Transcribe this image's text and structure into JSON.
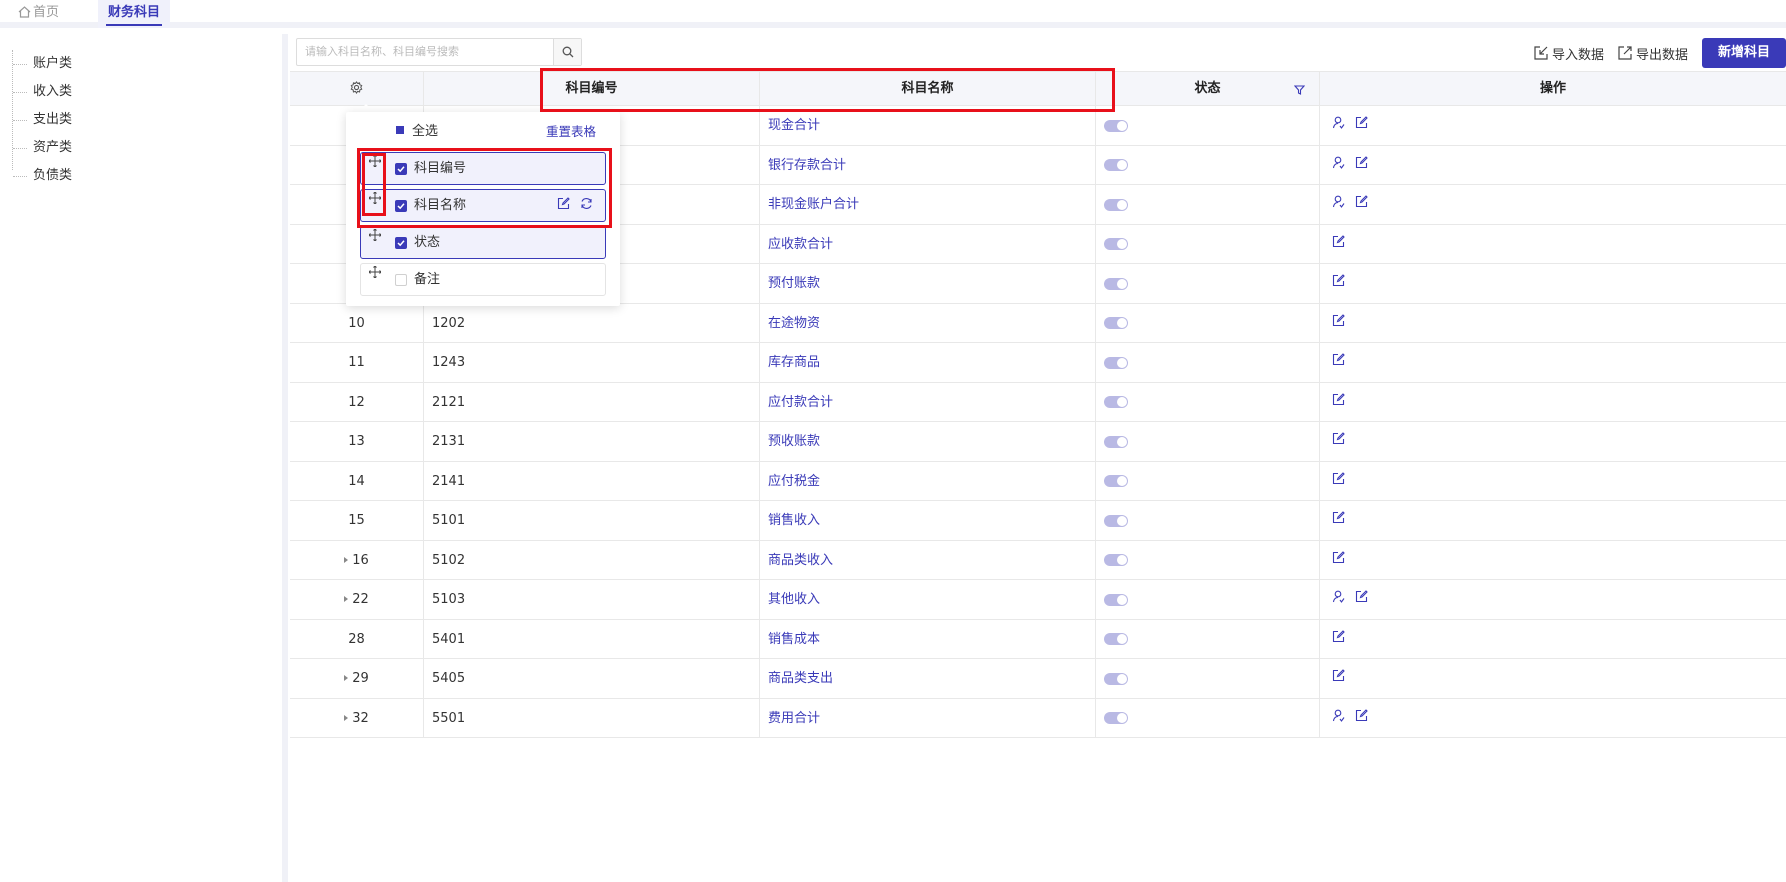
{
  "tabs": {
    "home": "首页",
    "active": "财务科目"
  },
  "sidebar": {
    "items": [
      "账户类",
      "收入类",
      "支出类",
      "资产类",
      "负债类"
    ]
  },
  "search": {
    "placeholder": "请输入科目名称、科目编号搜索"
  },
  "toolbar": {
    "import_label": "导入数据",
    "export_label": "导出数据",
    "add_label": "新增科目"
  },
  "table": {
    "columns": [
      "科目编号",
      "科目名称",
      "状态",
      "操作"
    ],
    "rows": [
      {
        "seq": "",
        "code": "",
        "name": "现金合计",
        "expand": false,
        "ops": [
          "user",
          "edit"
        ]
      },
      {
        "seq": "",
        "code": "",
        "name": "银行存款合计",
        "expand": false,
        "ops": [
          "user",
          "edit"
        ]
      },
      {
        "seq": "",
        "code": "",
        "name": "非现金账户合计",
        "expand": false,
        "ops": [
          "user",
          "edit"
        ]
      },
      {
        "seq": "",
        "code": "",
        "name": "应收款合计",
        "expand": false,
        "ops": [
          "edit"
        ]
      },
      {
        "seq": "",
        "code": "",
        "name": "预付账款",
        "expand": false,
        "ops": [
          "edit"
        ]
      },
      {
        "seq": "10",
        "code": "1202",
        "name": "在途物资",
        "expand": false,
        "ops": [
          "edit"
        ]
      },
      {
        "seq": "11",
        "code": "1243",
        "name": "库存商品",
        "expand": false,
        "ops": [
          "edit"
        ]
      },
      {
        "seq": "12",
        "code": "2121",
        "name": "应付款合计",
        "expand": false,
        "ops": [
          "edit"
        ]
      },
      {
        "seq": "13",
        "code": "2131",
        "name": "预收账款",
        "expand": false,
        "ops": [
          "edit"
        ]
      },
      {
        "seq": "14",
        "code": "2141",
        "name": "应付税金",
        "expand": false,
        "ops": [
          "edit"
        ]
      },
      {
        "seq": "15",
        "code": "5101",
        "name": "销售收入",
        "expand": false,
        "ops": [
          "edit"
        ]
      },
      {
        "seq": "16",
        "code": "5102",
        "name": "商品类收入",
        "expand": true,
        "ops": [
          "edit"
        ]
      },
      {
        "seq": "22",
        "code": "5103",
        "name": "其他收入",
        "expand": true,
        "ops": [
          "user",
          "edit"
        ]
      },
      {
        "seq": "28",
        "code": "5401",
        "name": "销售成本",
        "expand": false,
        "ops": [
          "edit"
        ]
      },
      {
        "seq": "29",
        "code": "5405",
        "name": "商品类支出",
        "expand": true,
        "ops": [
          "edit"
        ]
      },
      {
        "seq": "32",
        "code": "5501",
        "name": "费用合计",
        "expand": true,
        "ops": [
          "user",
          "edit"
        ]
      }
    ]
  },
  "column_popup": {
    "select_all": "全选",
    "reset": "重置表格",
    "items": [
      {
        "label": "科目编号",
        "checked": true
      },
      {
        "label": "科目名称",
        "checked": true
      },
      {
        "label": "状态",
        "checked": true
      },
      {
        "label": "备注",
        "checked": false
      }
    ]
  },
  "colors": {
    "accent": "#3a3ab8",
    "highlight": "#e8101a",
    "toggle": "#b9b9e4"
  }
}
